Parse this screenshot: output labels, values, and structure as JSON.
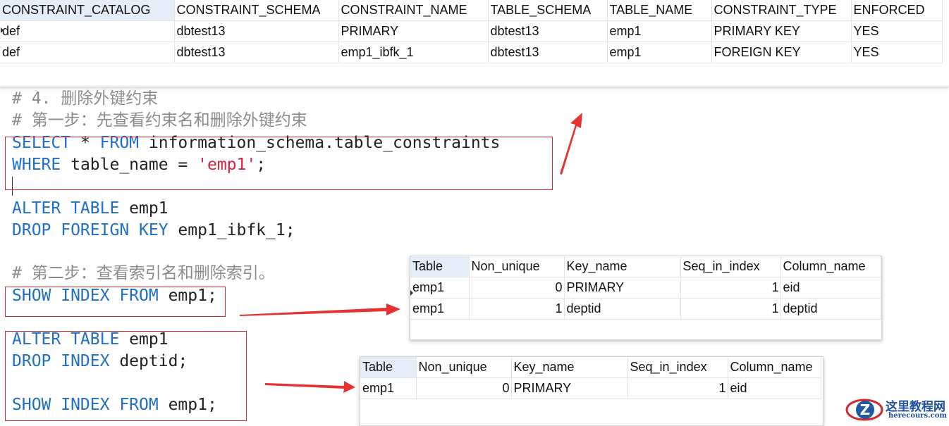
{
  "constraints_result": {
    "columns": [
      "CONSTRAINT_CATALOG",
      "CONSTRAINT_SCHEMA",
      "CONSTRAINT_NAME",
      "TABLE_SCHEMA",
      "TABLE_NAME",
      "CONSTRAINT_TYPE",
      "ENFORCED"
    ],
    "rows": [
      [
        "def",
        "dbtest13",
        "PRIMARY",
        "dbtest13",
        "emp1",
        "PRIMARY KEY",
        "YES"
      ],
      [
        "def",
        "dbtest13",
        "emp1_ibfk_1",
        "dbtest13",
        "emp1",
        "FOREIGN KEY",
        "YES"
      ]
    ]
  },
  "editor": {
    "comment1": "# 4. 删除外键约束",
    "comment2": "# 第一步：先查看约束名和删除外键约束",
    "kw_select": "SELECT",
    "select_rest": " * ",
    "kw_from": "FROM",
    "select_table": " information_schema.table_constraints",
    "kw_where": "WHERE",
    "where_rest": " table_name = ",
    "where_string": "'emp1'",
    "where_end": ";",
    "kw_alter_table": "ALTER TABLE",
    "alter_target": " emp1",
    "kw_drop_foreign_key": "DROP FOREIGN KEY",
    "drop_fk_rest": " emp1_ibfk_1;",
    "comment3": "# 第二步：查看索引名和删除索引。",
    "kw_show_index_from": "SHOW INDEX FROM",
    "show_rest": " emp1;",
    "kw_alter_table2": "ALTER TABLE",
    "alter_target2": " emp1",
    "kw_drop_index": "DROP INDEX",
    "drop_index_rest": " deptid;",
    "kw_show_index_from2": "SHOW INDEX FROM",
    "show_rest2": " emp1;"
  },
  "index_result_before": {
    "columns": [
      "Table",
      "Non_unique",
      "Key_name",
      "Seq_in_index",
      "Column_name"
    ],
    "rows": [
      [
        "emp1",
        "0",
        "PRIMARY",
        "1",
        "eid"
      ],
      [
        "emp1",
        "1",
        "deptid",
        "1",
        "deptid"
      ]
    ]
  },
  "index_result_after": {
    "columns": [
      "Table",
      "Non_unique",
      "Key_name",
      "Seq_in_index",
      "Column_name"
    ],
    "rows": [
      [
        "emp1",
        "0",
        "PRIMARY",
        "1",
        "eid"
      ]
    ]
  },
  "watermark": {
    "title": "这里教程网",
    "url": "herecours.com"
  },
  "colors": {
    "keyword": "#1f6fc6",
    "comment": "#8c8c8c",
    "string": "#d0233c",
    "annotation_red": "#d7272c",
    "header_highlight": "#e3eef9"
  },
  "icons": {
    "row_marker": "row-pointer-icon",
    "annotation": "red-arrow-icon"
  }
}
